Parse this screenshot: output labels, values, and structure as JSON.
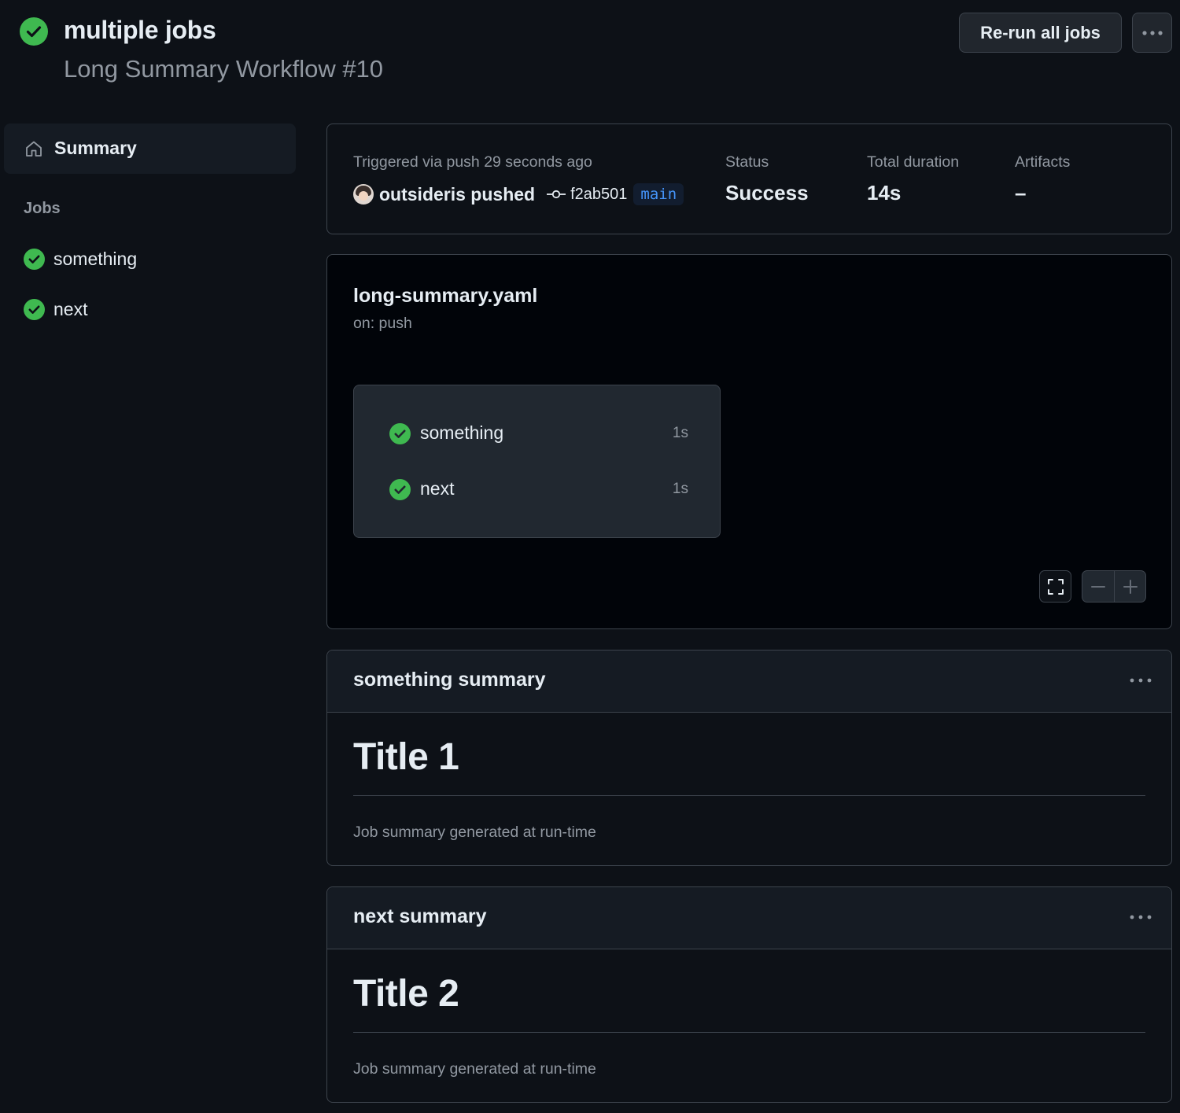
{
  "header": {
    "run_title": "multiple jobs",
    "workflow_name": "Long Summary Workflow #10",
    "rerun_label": "Re-run all jobs",
    "status_icon": "check-circle-fill-icon",
    "more_icon": "kebab-horizontal-icon"
  },
  "sidebar": {
    "summary_label": "Summary",
    "summary_icon": "home-icon",
    "jobs_heading": "Jobs",
    "jobs": [
      {
        "label": "something",
        "status_icon": "check-circle-fill-icon"
      },
      {
        "label": "next",
        "status_icon": "check-circle-fill-icon"
      }
    ]
  },
  "run_info": {
    "trigger_text": "Triggered via push 29 seconds ago",
    "pusher": "outsideris pushed",
    "commit_sha": "f2ab501",
    "branch": "main",
    "status_label": "Status",
    "status_value": "Success",
    "duration_label": "Total duration",
    "duration_value": "14s",
    "artifacts_label": "Artifacts",
    "artifacts_value": "–"
  },
  "graph": {
    "file_name": "long-summary.yaml",
    "trigger": "on: push",
    "jobs": [
      {
        "label": "something",
        "duration": "1s"
      },
      {
        "label": "next",
        "duration": "1s"
      }
    ]
  },
  "summaries": [
    {
      "title": "something summary",
      "heading": "Title 1",
      "text": "Job summary generated at run-time"
    },
    {
      "title": "next summary",
      "heading": "Title 2",
      "text": "Job summary generated at run-time"
    }
  ],
  "colors": {
    "background": "#0d1117",
    "success": "#3fb950",
    "accent_blue": "#4493f8",
    "border": "#3d444d"
  }
}
